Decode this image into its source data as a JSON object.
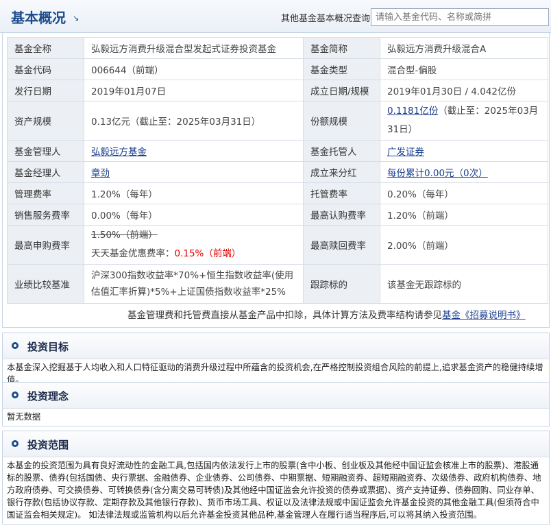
{
  "header": {
    "title": "基本概况",
    "title_arrow": "↘",
    "query_label": "其他基金基本概况查询:",
    "search_placeholder": "请输入基金代码、名称或简拼"
  },
  "info": {
    "full_name_label": "基金全称",
    "full_name": "弘毅远方消费升级混合型发起式证券投资基金",
    "short_name_label": "基金简称",
    "short_name": "弘毅远方消费升级混合A",
    "code_label": "基金代码",
    "code": "006644（前端）",
    "type_label": "基金类型",
    "type": "混合型-偏股",
    "issue_date_label": "发行日期",
    "issue_date": "2019年01月07日",
    "inception_label": "成立日期/规模",
    "inception": "2019年01月30日 / 4.042亿份",
    "asset_size_label": "资产规模",
    "asset_size": "0.13亿元（截止至：2025年03月31日）",
    "share_size_label": "份额规模",
    "share_size_link": "0.1181亿份",
    "share_size_rest": "（截止至：2025年03月31日）",
    "manager_co_label": "基金管理人",
    "manager_co": "弘毅远方基金",
    "custodian_label": "基金托管人",
    "custodian": "广发证券",
    "manager_label": "基金经理人",
    "manager": "章劲",
    "dividend_label": "成立来分红",
    "dividend": "每份累计0.00元（0次）",
    "mgmt_fee_label": "管理费率",
    "mgmt_fee": "1.20%（每年）",
    "custody_fee_label": "托管费率",
    "custody_fee": "0.20%（每年）",
    "sales_fee_label": "销售服务费率",
    "sales_fee": "0.00%（每年）",
    "max_sub_label": "最高认购费率",
    "max_sub": "1.20%（前端）",
    "max_purchase_label": "最高申购费率",
    "max_purchase_orig": "1.50%（前端）",
    "discount_label": "天天基金优惠费率：",
    "discount_rate": "0.15%（前端）",
    "max_redeem_label": "最高赎回费率",
    "max_redeem": "2.00%（前端）",
    "benchmark_label": "业绩比较基准",
    "benchmark": "沪深300指数收益率*70%+恒生指数收益率(使用估值汇率折算)*5%+上证国债指数收益率*25%",
    "tracking_label": "跟踪标的",
    "tracking": "该基金无跟踪标的"
  },
  "note": {
    "text": "基金管理费和托管费直接从基金产品中扣除，具体计算方法及费率结构请参见",
    "link": "基金《招募说明书》"
  },
  "sections": {
    "objective_title": "投资目标",
    "objective_text": "本基金深入挖掘基于人均收入和人口特征驱动的消费升级过程中所蕴含的投资机会,在严格控制投资组合风险的前提上,追求基金资产的稳健持续增值。",
    "philosophy_title": "投资理念",
    "philosophy_text": "暂无数据",
    "scope_title": "投资范围",
    "scope_text": "本基金的投资范围为具有良好流动性的金融工具,包括国内依法发行上市的股票(含中小板、创业板及其他经中国证监会核准上市的股票)、港股通标的股票、债券(包括国债、央行票据、金融债券、企业债券、公司债券、中期票据、短期融资券、超短期融资券、次级债券、政府机构债券、地方政府债券、可交换债券、可转换债券(含分离交易可转债)及其他经中国证监会允许投资的债券或票据)、资产支持证券、债券回购、同业存单、银行存款(包括协议存款、定期存款及其他银行存款)、货币市场工具、权证以及法律法规或中国证监会允许基金投资的其他金融工具(但须符合中国证监会相关规定)。 如法律法规或监管机构以后允许基金投资其他品种,基金管理人在履行适当程序后,可以将其纳入投资范围。"
  }
}
